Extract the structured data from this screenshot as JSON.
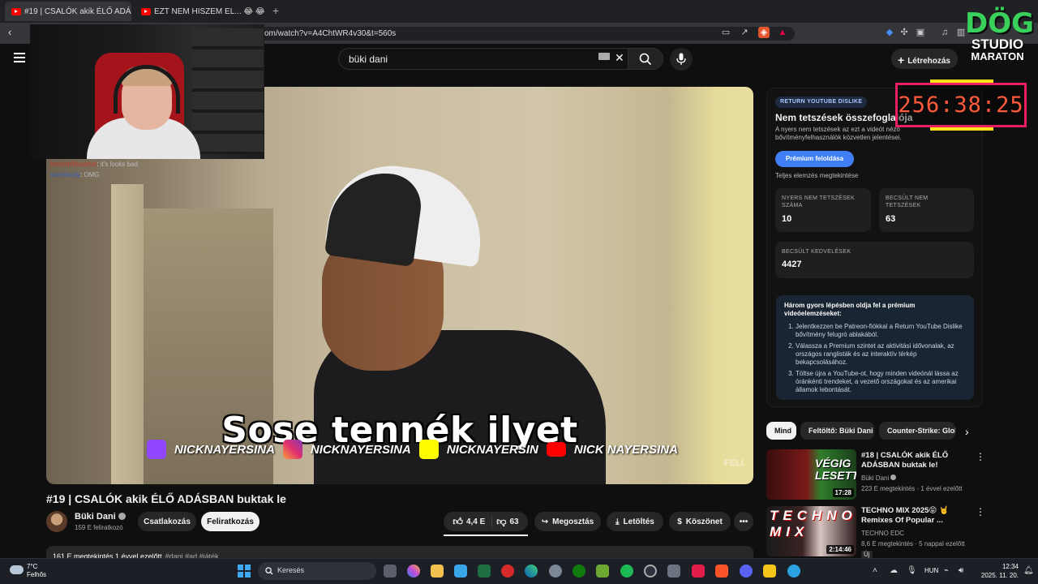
{
  "browser": {
    "tabs": [
      {
        "title": "#19 | CSALÓK akik ÉLŐ ADÁS"
      },
      {
        "title": "EZT NEM HISZEM EL... 😂 😂 | DÖG S"
      }
    ],
    "new_tab": "+",
    "url": "om/watch?v=A4ChtWR4v30&t=560s"
  },
  "youtube": {
    "search_value": "büki dani",
    "create_label": "Létrehozás"
  },
  "video": {
    "subtitle": "Sose tennék ilyet",
    "socials": [
      "NICKNAYERSINA",
      "NICKNAYERSINA",
      "NICKNAYERSIN",
      "NICK NAYERSINA"
    ],
    "watermark": "FELI"
  },
  "chat": [
    {
      "user": "brecklefiltssehet",
      "msg": "it's looks bad"
    },
    {
      "user": "somebody",
      "msg": "OMG"
    }
  ],
  "meta": {
    "title": "#19 | CSALÓK akik ÉLŐ ADÁSBAN buktak le",
    "channel": "Büki Dani",
    "subscribers": "159 E feliratkozó",
    "join": "Csatlakozás",
    "subscribe": "Feliratkozás",
    "likes": "4,4 E",
    "dislikes": "63",
    "share": "Megosztás",
    "download": "Letöltés",
    "thanks": "Köszönet",
    "more": "•••",
    "views_date": "161 E megtekintés  1 évvel ezelőtt",
    "tags": "#dani #ad #játék"
  },
  "ryd": {
    "badge": "RETURN YOUTUBE DISLIKE",
    "title": "Nem tetszések összefoglalója",
    "desc": "A nyers nem tetszések az ezt a videót néző bővítményfelhasználók közvetlen jelentései.",
    "button": "Prémium feloldása",
    "link": "Teljes elemzés megtekintése",
    "stats": [
      {
        "label": "NYERS NEM TETSZÉSEK SZÁMA",
        "value": "10"
      },
      {
        "label": "BECSÜLT NEM TETSZÉSEK",
        "value": "63"
      },
      {
        "label": "BECSÜLT KEDVELÉSEK",
        "value": "4427"
      }
    ],
    "steps_heading": "Három gyors lépésben oldja fel a prémium videóelemzéseket:",
    "steps": [
      "Jelentkezzen be Patreon-fiókkal a Return YouTube Dislike bővítmény felugró ablakából.",
      "Válassza a Premium szintet az aktivitási idővonalak, az országos ranglisták és az interaktív térkép bekapcsolásához.",
      "Töltse újra a YouTube-ot, hogy minden videónál lássa az óránkénti trendeket, a vezető országokat és az amerikai államok lebontását."
    ]
  },
  "overlay": {
    "timer": "256:38:25",
    "brand_l1": "DÖG",
    "brand_l2": "STUDIO",
    "brand_l3": "MARATON"
  },
  "chips": [
    "Mind",
    "Feltöltő: Büki Dani",
    "Counter-Strike: Glob"
  ],
  "recommendations": [
    {
      "title": "#18 | CSALÓK akik ÉLŐ ADÁSBAN buktak le!",
      "channel": "Büki Dani",
      "meta": "223 E megtekintés · 1 évvel ezelőtt",
      "duration": "17:28",
      "thumb_text": "VÉGIG LESETT?"
    },
    {
      "title": "TECHNO MIX 2025😝 🤘 Remixes Of Popular ...",
      "channel": "TECHNO EDC",
      "meta": "8,6 E megtekintés · 5 nappal ezelőtt",
      "badge": "Új",
      "duration": "2:14:46",
      "thumb_text": "TECHNO MIX"
    }
  ],
  "taskbar": {
    "temp": "7°C",
    "weather": "Felhős",
    "search": "Keresés",
    "lang": "HUN",
    "time": "12:34",
    "date": "2025. 11. 20."
  }
}
